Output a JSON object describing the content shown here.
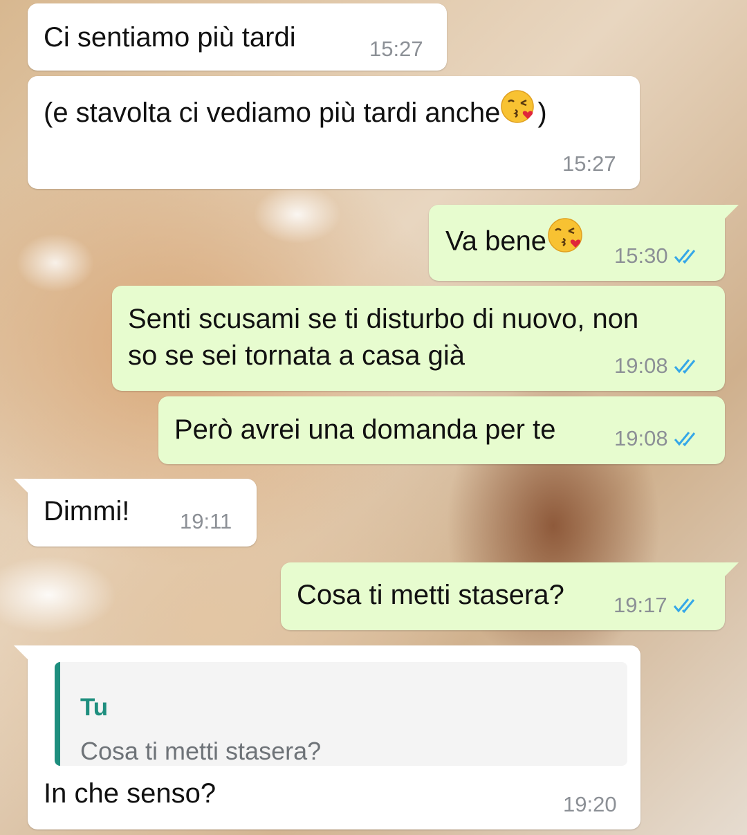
{
  "messages": [
    {
      "direction": "incoming",
      "text": "Ci sentiamo più tardi",
      "time": "15:27"
    },
    {
      "direction": "incoming",
      "text": "(e stavolta ci vediamo più tardi anche",
      "text_after": ")",
      "emoji": "kissing-heart-emoji",
      "time": "15:27"
    },
    {
      "direction": "outgoing",
      "text": "Va bene",
      "emoji": "kissing-heart-emoji",
      "time": "15:30",
      "status": "read"
    },
    {
      "direction": "outgoing",
      "line1": "Senti scusami se ti disturbo di nuovo, non",
      "line2": "so se sei tornata a casa già",
      "time": "19:08",
      "status": "read"
    },
    {
      "direction": "outgoing",
      "text": "Però avrei una domanda per te",
      "time": "19:08",
      "status": "read"
    },
    {
      "direction": "incoming",
      "text": "Dimmi!",
      "time": "19:11"
    },
    {
      "direction": "outgoing",
      "text": "Cosa ti metti stasera?",
      "time": "19:17",
      "status": "read"
    },
    {
      "direction": "incoming",
      "quote": {
        "author": "Tu",
        "text": "Cosa ti metti stasera?"
      },
      "text": "In che senso?",
      "time": "19:20"
    }
  ],
  "colors": {
    "incoming_bubble": "#ffffff",
    "outgoing_bubble": "#e7fccf",
    "timestamp": "#8c9096",
    "read_tick": "#35a7e8",
    "quote_accent": "#1e8e7e"
  }
}
